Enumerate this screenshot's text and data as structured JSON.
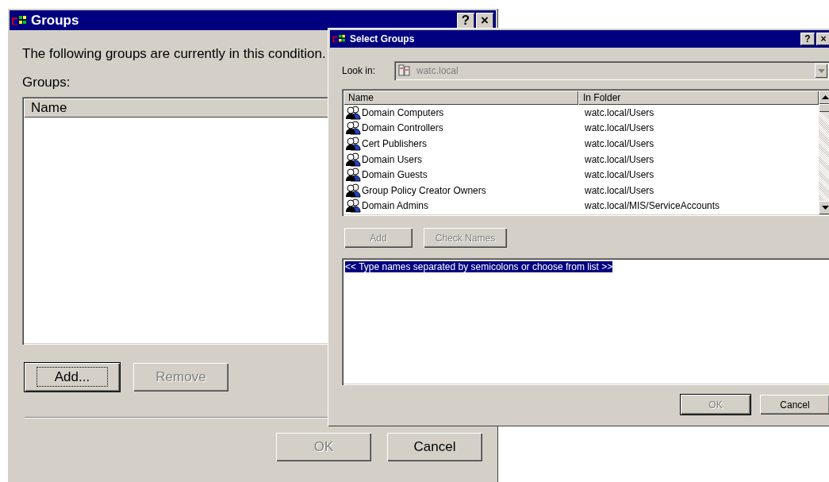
{
  "groups_dialog": {
    "title": "Groups",
    "description": "The following groups are currently in this condition.",
    "groups_label": "Groups:",
    "list": {
      "columns": [
        "Name"
      ]
    },
    "buttons": [
      {
        "label": "Add...",
        "disabled": false,
        "focused": true
      },
      {
        "label": "Remove",
        "disabled": true,
        "focused": false
      }
    ],
    "footer_buttons": [
      {
        "label": "OK",
        "disabled": true
      },
      {
        "label": "Cancel",
        "disabled": false
      }
    ],
    "title_buttons": [
      "?",
      "×"
    ]
  },
  "select_dialog": {
    "title": "Select Groups",
    "title_buttons": [
      "?",
      "×"
    ],
    "look_in": {
      "label": "Look in:",
      "value": "watc.local",
      "disabled": true
    },
    "list": {
      "columns": [
        "Name",
        "In Folder"
      ],
      "rows": [
        {
          "name": "Domain Computers",
          "folder": "watc.local/Users"
        },
        {
          "name": "Domain Controllers",
          "folder": "watc.local/Users"
        },
        {
          "name": "Cert Publishers",
          "folder": "watc.local/Users"
        },
        {
          "name": "Domain Users",
          "folder": "watc.local/Users"
        },
        {
          "name": "Domain Guests",
          "folder": "watc.local/Users"
        },
        {
          "name": "Group Policy Creator Owners",
          "folder": "watc.local/Users"
        },
        {
          "name": "Domain Admins",
          "folder": "watc.local/MIS/ServiceAccounts"
        }
      ]
    },
    "buttons": [
      {
        "label": "Add",
        "disabled": true
      },
      {
        "label": "Check Names",
        "disabled": true
      }
    ],
    "names_field": {
      "value": "<< Type names separated by semicolons or choose from list >>",
      "selected": true
    },
    "footer_buttons": [
      {
        "label": "OK",
        "disabled": true
      },
      {
        "label": "Cancel",
        "disabled": false
      }
    ]
  }
}
